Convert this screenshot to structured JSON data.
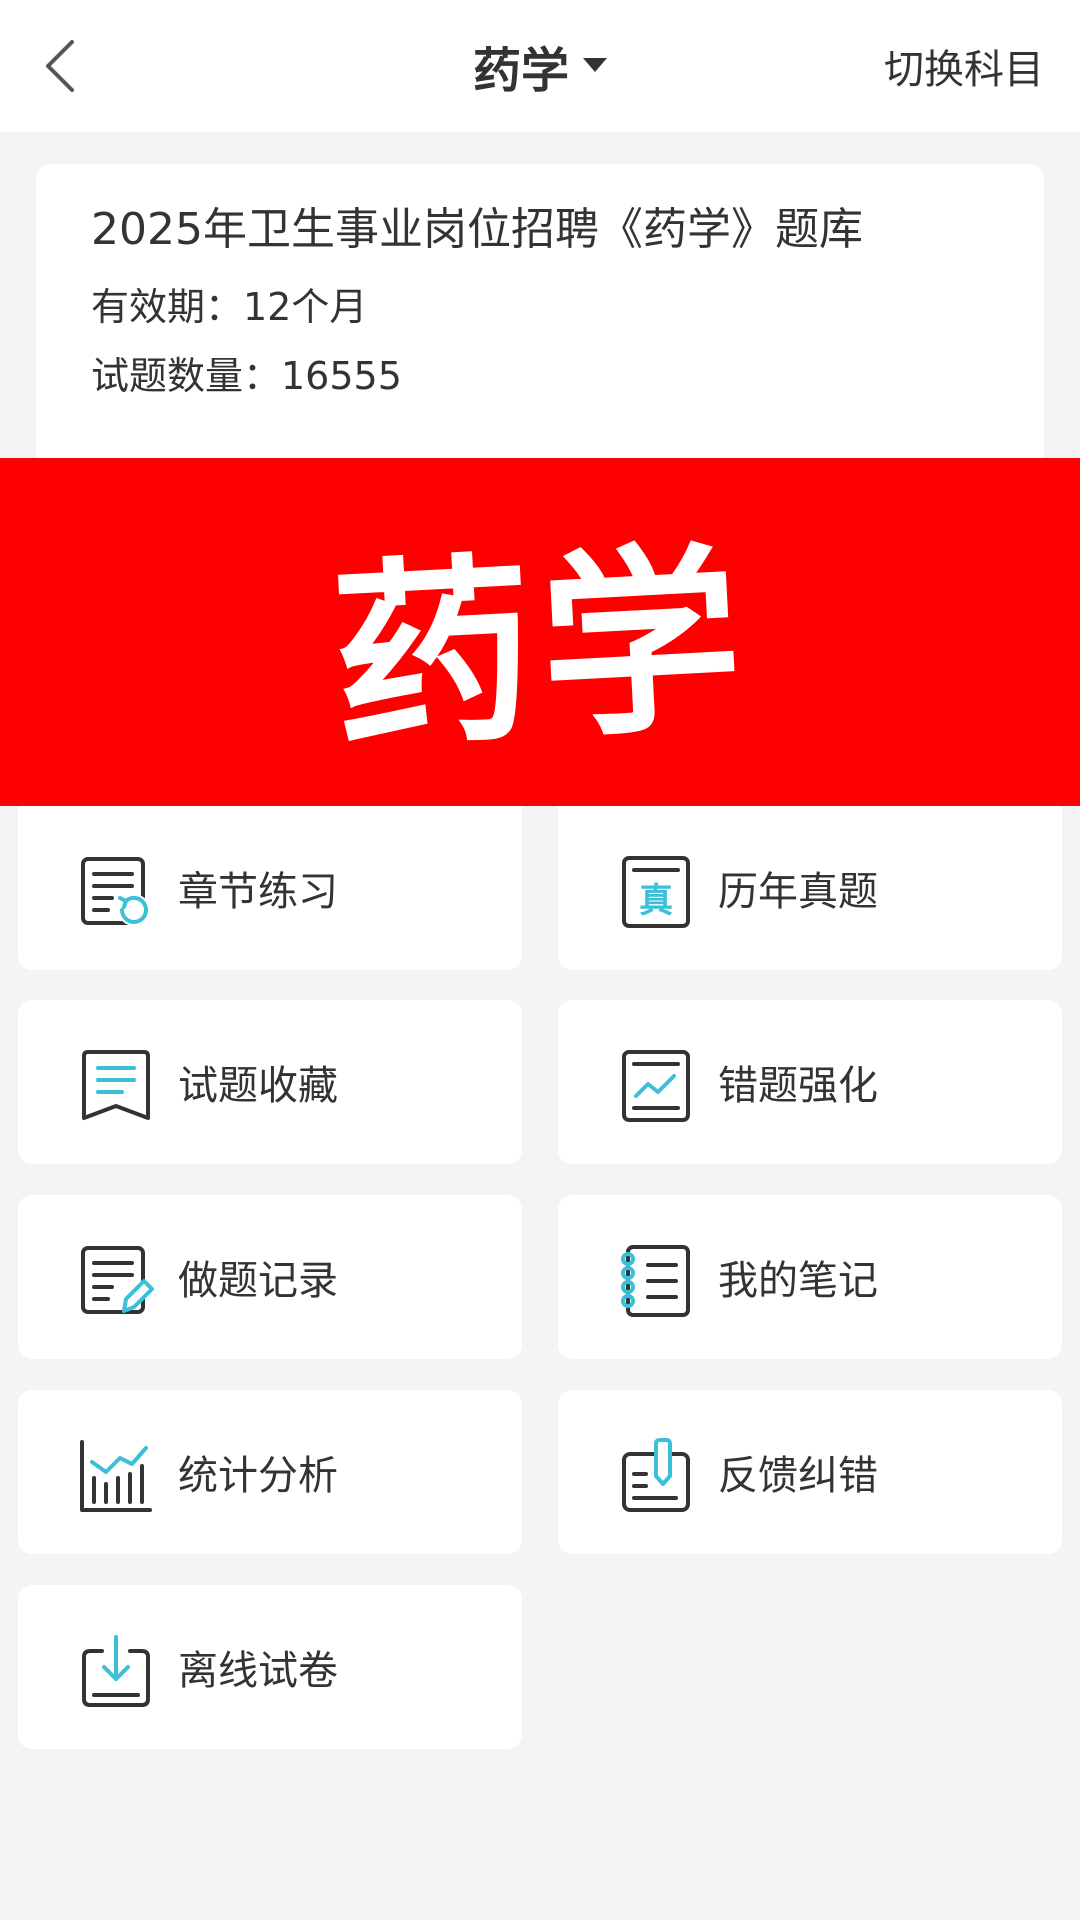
{
  "header": {
    "title": "药学",
    "switch_label": "切换科目"
  },
  "info": {
    "title": "2025年卫生事业岗位招聘《药学》题库",
    "validity": "有效期：12个月",
    "count": "试题数量：16555"
  },
  "banner": {
    "text": "药学"
  },
  "menu": {
    "items": [
      {
        "label": "章节练习",
        "icon": "chapter-practice-icon"
      },
      {
        "label": "历年真题",
        "icon": "past-exams-icon"
      },
      {
        "label": "试题收藏",
        "icon": "bookmark-icon"
      },
      {
        "label": "错题强化",
        "icon": "wrong-question-icon"
      },
      {
        "label": "做题记录",
        "icon": "record-icon"
      },
      {
        "label": "我的笔记",
        "icon": "notes-icon"
      },
      {
        "label": "统计分析",
        "icon": "statistics-icon"
      },
      {
        "label": "反馈纠错",
        "icon": "feedback-icon"
      },
      {
        "label": "离线试卷",
        "icon": "download-icon"
      }
    ]
  },
  "colors": {
    "accent": "#3cc0d8",
    "banner": "#ff0000",
    "icon_stroke": "#333333",
    "background": "#f4f4f4"
  }
}
